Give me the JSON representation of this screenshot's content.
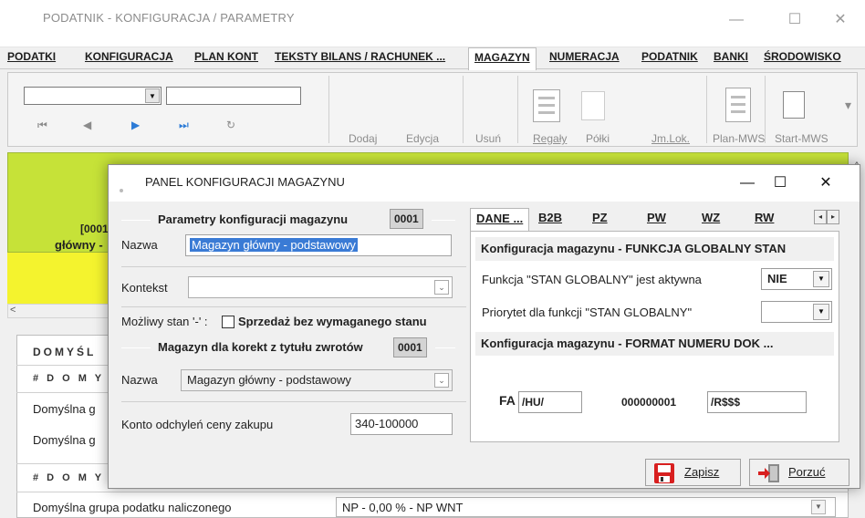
{
  "window": {
    "title": "PODATNIK - KONFIGURACJA / PARAMETRY",
    "minimize": "—",
    "maximize": "☐",
    "close": "✕"
  },
  "menu": {
    "tabs": [
      "PODATKI",
      "KONFIGURACJA",
      "PLAN KONT",
      "TEKSTY BILANS / RACHUNEK ...",
      "MAGAZYN",
      "NUMERACJA",
      "PODATNIK",
      "BANKI",
      "ŚRODOWISKO"
    ],
    "active": "MAGAZYN"
  },
  "toolbar": {
    "nav": {
      "first": "⏮",
      "prev": "◀",
      "next": "▶",
      "last": "⏭",
      "refresh": "↻"
    },
    "buttons": {
      "add": "Dodaj",
      "edit": "Edycja",
      "delete": "Usuń",
      "racks": "Regały",
      "shelves": "Półki",
      "jm_lok": "Jm.Lok.",
      "plan_mws": "Plan-MWS",
      "start_mws": "Start-MWS"
    },
    "more": "▾"
  },
  "background": {
    "code_partial": "[0001",
    "name_partial": "główny -",
    "section_partial": "DOMYŚL",
    "subsection_partial_1": "# D O M Y Ś",
    "row_partial_1": "Domyślna g",
    "row_partial_2": "Domyślna g",
    "subsection_partial_2": "# D O M Y Ś",
    "vat_label": "Domyślna grupa podatku naliczonego",
    "vat_value": "NP - 0,00 %  - NP WNT"
  },
  "dialog": {
    "title": "PANEL KONFIGURACJI MAGAZYNU",
    "minimize": "—",
    "maximize": "☐",
    "close": "✕",
    "params_group": {
      "title": "Parametry  konfiguracji  magazynu",
      "code": "0001",
      "name_label": "Nazwa",
      "name_value": "Magazyn główny - podstawowy",
      "context_label": "Kontekst",
      "context_value": "",
      "negative_stock_label": "Możliwy stan '-' :",
      "negative_stock_checkbox_label": "Sprzedaż bez wymaganego stanu",
      "negative_stock_checked": false
    },
    "returns_group": {
      "title": "Magazyn dla korekt z tytułu zwrotów",
      "code": "0001",
      "name_label": "Nazwa",
      "name_value": "Magazyn główny - podstawowy"
    },
    "price_deviation_label": "Konto odchyleń  ceny  zakupu",
    "price_deviation_value": "340-100000",
    "tabs": [
      "DANE ...",
      "B2B",
      "PZ",
      "PW",
      "WZ",
      "RW"
    ],
    "active_tab": "DANE ...",
    "tab_scroll_left": "◂",
    "tab_scroll_right": "▸",
    "global_stock": {
      "header": "Konfiguracja magazynu  -  FUNKCJA GLOBALNY STAN",
      "active_label": "Funkcja \"STAN GLOBALNY\" jest aktywna",
      "active_value": "NIE",
      "priority_label": "Priorytet dla funkcji \"STAN GLOBALNY\"",
      "priority_value": ""
    },
    "doc_format": {
      "header": "Konfiguracja magazynu  -  FORMAT NUMERU DOK ...",
      "prefix_label": "FA",
      "part1": "/HU/",
      "number": "000000001",
      "suffix": "/R$$$"
    },
    "save_button": "Zapisz",
    "cancel_button": "Porzuć"
  }
}
